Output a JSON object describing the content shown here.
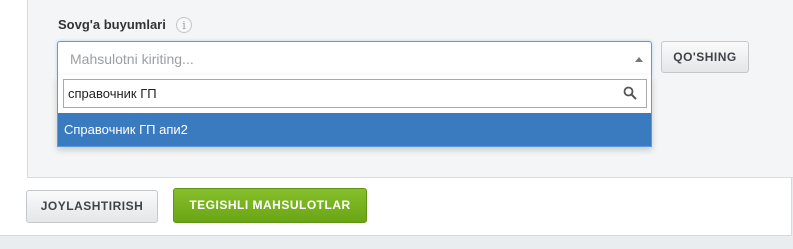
{
  "gifts": {
    "label": "Sovg'a buyumlari",
    "info_icon": "info-icon",
    "select_placeholder": "Mahsulotni kiriting...",
    "search_value": "справочник ГП",
    "search_icon": "search-icon",
    "highlighted_option": "Справочник ГП апи2",
    "add_button": "QO'SHING"
  },
  "footer": {
    "place_button": "JOYLASHTIRISH",
    "related_button": "TEGISHLI MAHSULOTLAR"
  },
  "colors": {
    "highlight": "#3a7bbf",
    "focus_border": "#5b9ce0",
    "primary_green": "#77b21f"
  }
}
